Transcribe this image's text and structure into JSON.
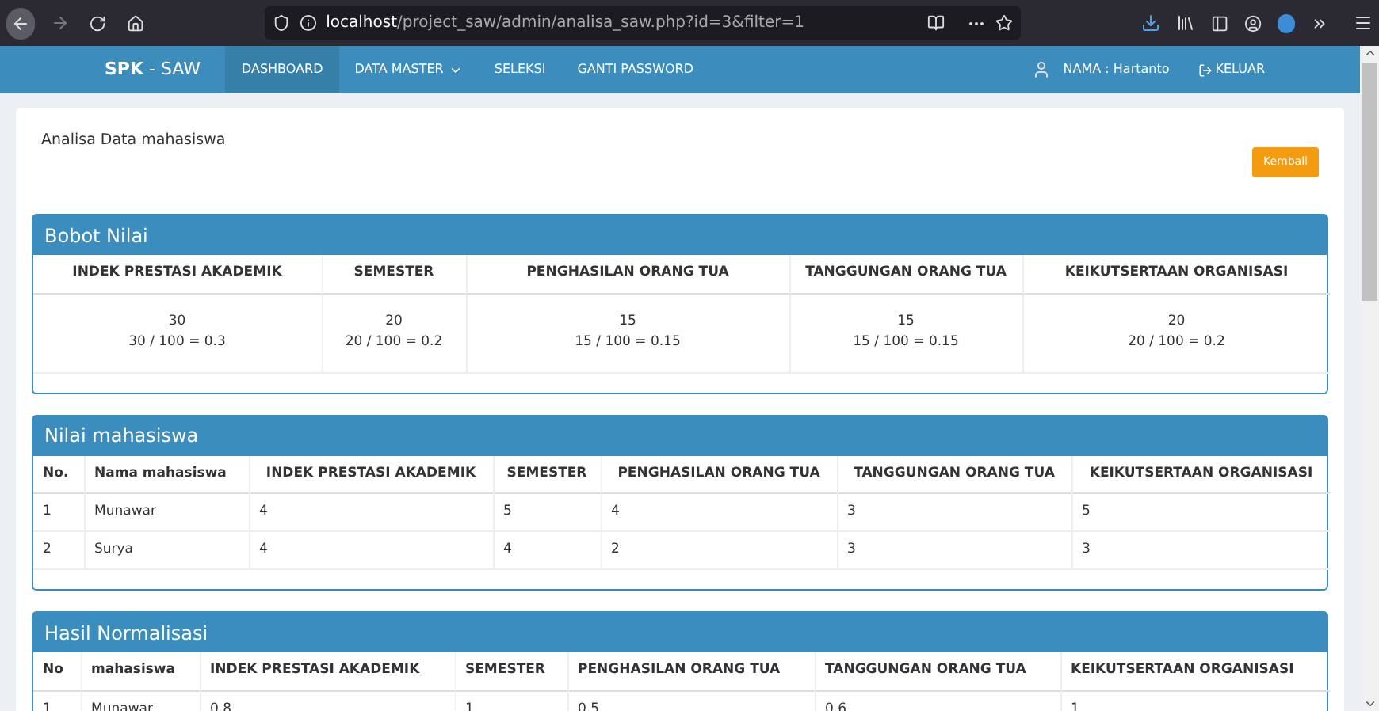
{
  "browser": {
    "url": "**localhost**/project_saw/admin/analisa_saw.php?id=3&filter=1"
  },
  "navbar": {
    "brand_bold": "SPK",
    "brand_rest": " - SAW",
    "items": [
      {
        "label": "DASHBOARD",
        "selected": true,
        "dropdown": false
      },
      {
        "label": "DATA MASTER",
        "selected": false,
        "dropdown": true
      },
      {
        "label": "SELEKSI",
        "selected": false,
        "dropdown": false
      },
      {
        "label": "GANTI PASSWORD",
        "selected": false,
        "dropdown": false
      }
    ],
    "user": "NAMA : Hartanto",
    "logout": "KELUAR"
  },
  "page": {
    "title": "Analisa Data mahasiswa",
    "back_button": "Kembali"
  },
  "panels": [
    {
      "title": "Bobot Nilai",
      "kind": "weights",
      "columns": [
        "INDEK PRESTASI AKADEMIK",
        "SEMESTER",
        "PENGHASILAN ORANG TUA",
        "TANGGUNGAN ORANG TUA",
        "KEIKUTSERTAAN ORGANISASI"
      ],
      "rows": [
        [
          "30\n30 / 100 = 0.3",
          "20\n20 / 100 = 0.2",
          "15\n15 / 100 = 0.15",
          "15\n15 / 100 = 0.15",
          "20\n20 / 100 = 0.2"
        ]
      ]
    },
    {
      "title": "Nilai mahasiswa",
      "kind": "values",
      "columns": [
        "No.",
        "Nama mahasiswa",
        "INDEK PRESTASI AKADEMIK",
        "SEMESTER",
        "PENGHASILAN ORANG TUA",
        "TANGGUNGAN ORANG TUA",
        "KEIKUTSERTAAN ORGANISASI"
      ],
      "rows": [
        [
          "1",
          "Munawar",
          "4",
          "5",
          "4",
          "3",
          "5"
        ],
        [
          "2",
          "Surya",
          "4",
          "4",
          "2",
          "3",
          "3"
        ]
      ]
    },
    {
      "title": "Hasil Normalisasi",
      "kind": "normalized",
      "columns": [
        "No",
        "mahasiswa",
        "INDEK PRESTASI AKADEMIK",
        "SEMESTER",
        "PENGHASILAN ORANG TUA",
        "TANGGUNGAN ORANG TUA",
        "KEIKUTSERTAAN ORGANISASI"
      ],
      "rows": [
        [
          "1",
          "Munawar",
          "0.8",
          "1",
          "0.5",
          "0.6",
          "1"
        ]
      ]
    }
  ]
}
